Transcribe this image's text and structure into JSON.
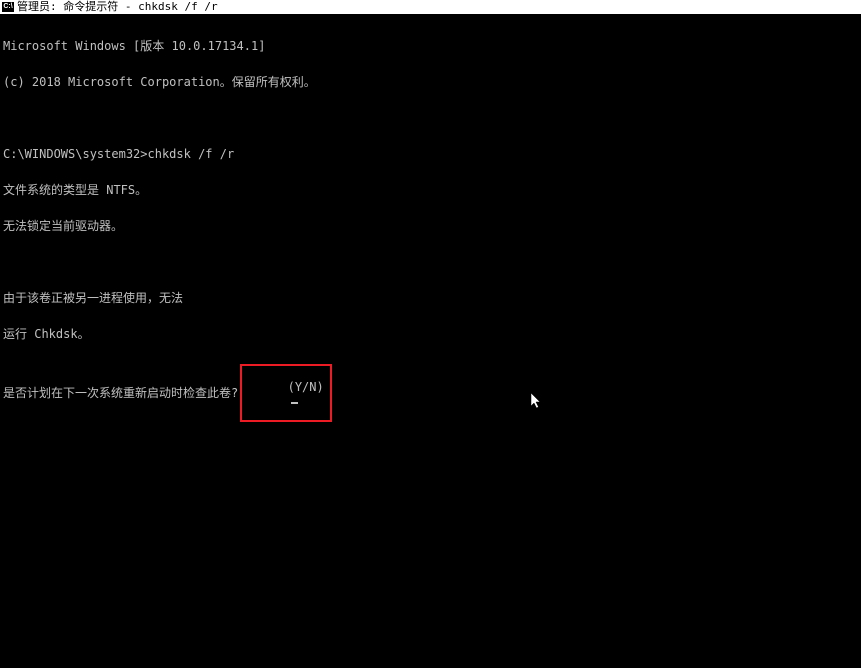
{
  "titlebar": {
    "icon_label": "C:\\",
    "title": "管理员: 命令提示符 - chkdsk  /f /r"
  },
  "terminal": {
    "line1": "Microsoft Windows [版本 10.0.17134.1]",
    "line2": "(c) 2018 Microsoft Corporation。保留所有权利。",
    "line3": "",
    "line4": "C:\\WINDOWS\\system32>chkdsk /f /r",
    "line5": "文件系统的类型是 NTFS。",
    "line6": "无法锁定当前驱动器。",
    "line7": "",
    "line8": "由于该卷正被另一进程使用，无法",
    "line9": "运行 Chkdsk。",
    "prompt_text": "是否计划在下一次系统重新启动时检查此卷?",
    "prompt_yn": "(Y/N)"
  }
}
